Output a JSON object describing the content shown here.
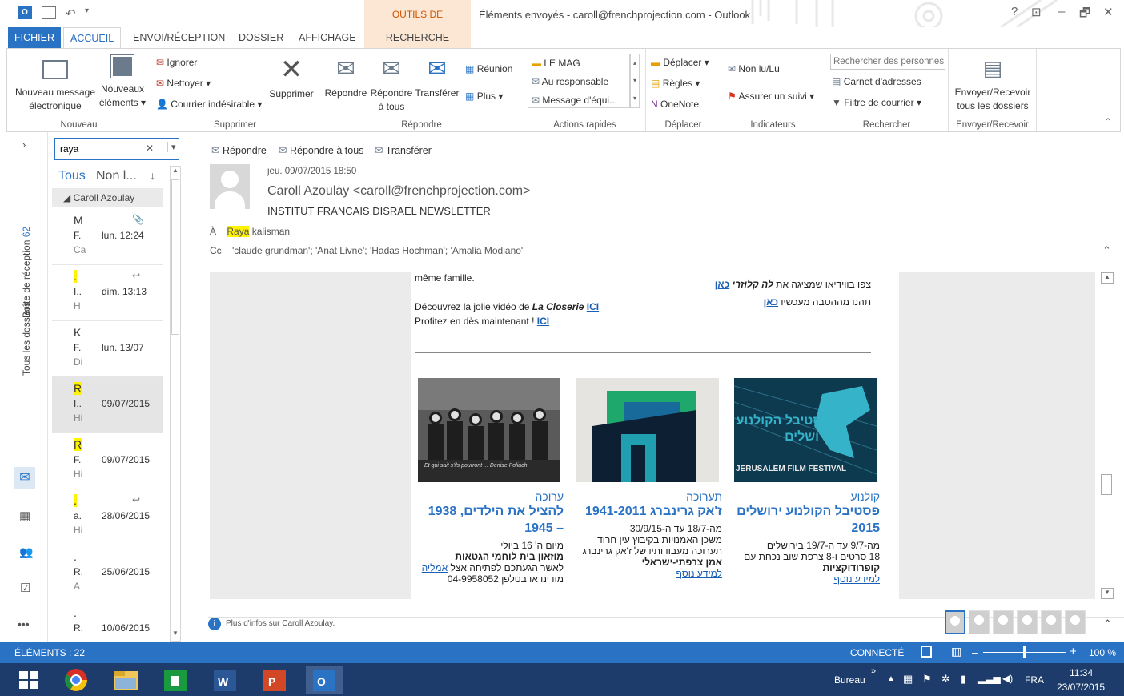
{
  "title_bar": {
    "context_tab": "OUTILS DE RECHERCHE",
    "window_title": "Éléments envoyés - caroll@frenchprojection.com - Outlook",
    "help": "?",
    "restore_ribbon": "⊡",
    "minimize": "–",
    "restore": "🗗",
    "close": "✕"
  },
  "tabs": [
    "FICHIER",
    "ACCUEIL",
    "ENVOI/RÉCEPTION",
    "DOSSIER",
    "AFFICHAGE",
    "RECHERCHE"
  ],
  "ribbon": {
    "nouveau": {
      "new_message": "Nouveau message électronique",
      "new_items": "Nouveaux éléments ▾",
      "label": "Nouveau"
    },
    "supprimer": {
      "ignorer": "Ignorer",
      "nettoyer": "Nettoyer ▾",
      "courrier": "Courrier indésirable ▾",
      "supprimer": "Supprimer",
      "label": "Supprimer"
    },
    "repondre": {
      "repondre": "Répondre",
      "repondre_tous": "Répondre à tous",
      "transferer": "Transférer",
      "reunion": "Réunion",
      "plus": "Plus ▾",
      "label": "Répondre"
    },
    "actions": {
      "items": [
        "LE MAG",
        "Au responsable",
        "Message d'équi..."
      ],
      "label": "Actions rapides"
    },
    "deplacer": {
      "deplacer": "Déplacer ▾",
      "regles": "Règles ▾",
      "onenote": "OneNote",
      "label": "Déplacer"
    },
    "indicateurs": {
      "non_lu": "Non lu/Lu",
      "assurer": "Assurer un suivi ▾",
      "label": "Indicateurs"
    },
    "rechercher": {
      "placeholder": "Rechercher des personnes",
      "carnet": "Carnet d'adresses",
      "filtre": "Filtre de courrier ▾",
      "label": "Rechercher"
    },
    "envoyer": {
      "button": "Envoyer/Recevoir tous les dossiers",
      "label": "Envoyer/Recevoir"
    }
  },
  "leftnav": {
    "inbox": "Boîte de réception",
    "inbox_count": "62",
    "all_folders": "Tous les dossiers",
    "more": "•••"
  },
  "search": {
    "value": "raya",
    "clear": "✕",
    "dropdown": "▾"
  },
  "filters": {
    "all": "Tous",
    "unread": "Non l...",
    "sort": "↓"
  },
  "group_header": "◢ Caroll Azoulay",
  "messages": [
    {
      "line1": "M",
      "line2": "F.",
      "line3": "Ca",
      "date": "lun. 12:24",
      "flag": "📎"
    },
    {
      "line1": ".",
      "line2": "I..",
      "line3": "H",
      "date": "dim. 13:13",
      "flag": "↩"
    },
    {
      "line1": "K",
      "line2": "F.",
      "line3": "Di",
      "date": "lun. 13/07",
      "flag": ""
    },
    {
      "line1": "R",
      "line2": "I..",
      "line3": "Hi",
      "date": "09/07/2015",
      "flag": ""
    },
    {
      "line1": "R",
      "line2": "F.",
      "line3": "Hi",
      "date": "09/07/2015",
      "flag": ""
    },
    {
      "line1": ".",
      "line2": "a.",
      "line3": "Hi",
      "date": "28/06/2015",
      "flag": "↩"
    },
    {
      "line1": ".",
      "line2": "R.",
      "line3": "A",
      "date": "25/06/2015",
      "flag": ""
    },
    {
      "line1": ".",
      "line2": "R.",
      "line3": "",
      "date": "10/06/2015",
      "flag": ""
    }
  ],
  "reading": {
    "actions": {
      "reply": "Répondre",
      "reply_all": "Répondre à tous",
      "forward": "Transférer"
    },
    "date": "jeu. 09/07/2015 18:50",
    "from": "Caroll Azoulay <caroll@frenchprojection.com>",
    "subject": "INSTITUT FRANCAIS DISRAEL NEWSLETTER",
    "to_label": "À",
    "to_name": "Raya",
    "to_rest": " kalisman",
    "cc_label": "Cc",
    "cc": "'claude grundman'; 'Anat Livne'; 'Hadas Hochman'; 'Amalia Modiano'",
    "footer": "Plus d'infos sur Caroll Azoulay."
  },
  "body": {
    "fr1": "même famille.",
    "fr2_pre": "Découvrez la jolie vidéo de ",
    "fr2_em": "La Closerie",
    "fr2_link": "ICI",
    "fr3_pre": "Profitez en dès maintenant ! ",
    "fr3_link": "ICI",
    "he1_pre": "צפו בווידיאו שמציגה את ",
    "he1_em": "לה קלוזרי",
    "he1_link": "כאן",
    "he2_pre": "תהנו מההטבה מעכשיו ",
    "he2_link": "כאן",
    "cards": [
      {
        "cat": "ערוכה",
        "title": "להציל את הילדים, 1938 – 1945",
        "l1": "מיום ה' 16 ביולי",
        "l2": "מוזאון בית לוחמי הגטאות",
        "l3_pre": "לאשר הגעתכם לפתיחה אצל ",
        "l3_link": "אמליה",
        "l4": "מודינו או בטלפן 04-9958052"
      },
      {
        "cat": "תערוכה",
        "title": "ז'אק גרינברג 1941-2011",
        "l1": "מה-18/7 עד ה-30/9/15",
        "l2": "משכן האמנויות בקיבוץ עין חרוד",
        "l3": "תערוכה מעבודותיו של ז'אק גרינברג",
        "l4": "אמן צרפתי-ישראלי",
        "link": "למידע נוסף"
      },
      {
        "cat": "קולנוע",
        "title": "פסטיבל הקולנוע ירושלים 2015",
        "l1": "מה-9/7 עד ה-19/7 בירושלים",
        "l2": "18 סרטים ו-8 צרפת שוב נכחת עם",
        "l3": "קופרודוקציות",
        "link": "למידע נוסף",
        "img_text": "פסטיבל הקולנוע ירושלים",
        "img_sub": "JERUSALEM FILM FESTIVAL"
      }
    ],
    "img1_caption": "Et qui sait s'ils pourront ... Denise Poliach"
  },
  "status": {
    "items": "ÉLÉMENTS : 22",
    "connected": "CONNECTÉ",
    "zoom": "100 %"
  },
  "taskbar": {
    "bureau": "Bureau",
    "lang": "FRA",
    "time": "11:34",
    "date": "23/07/2015"
  },
  "colors": {
    "accent": "#2a72c4",
    "context": "#d35400",
    "link": "#1a5fb4"
  }
}
